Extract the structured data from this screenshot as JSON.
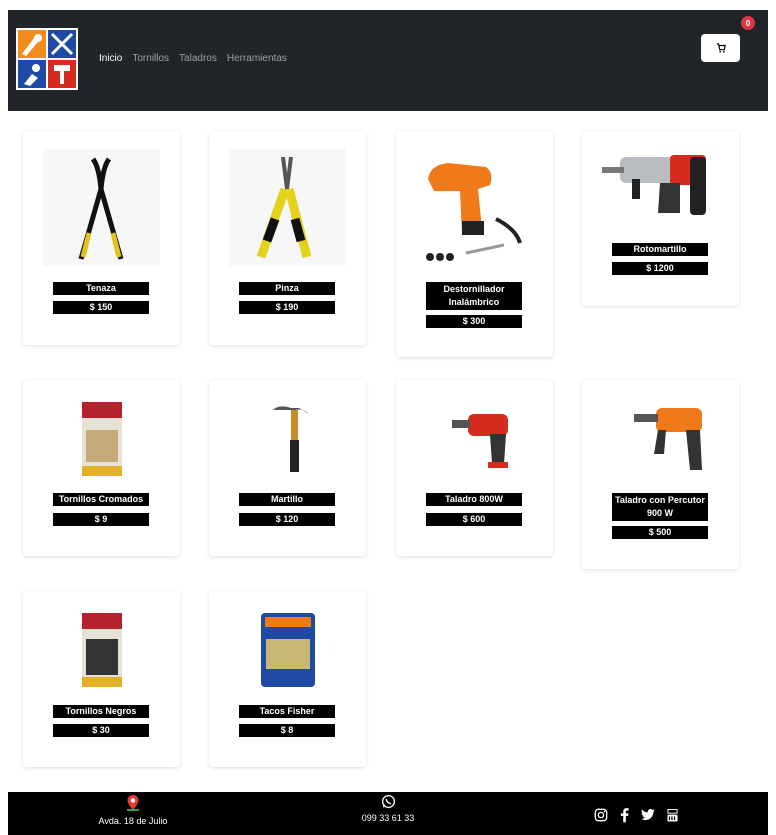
{
  "nav": {
    "links": [
      {
        "label": "Inicio"
      },
      {
        "label": "Tornillos"
      },
      {
        "label": "Taladros"
      },
      {
        "label": "Herramientas"
      }
    ],
    "cart_count": "0",
    "cart_icon": "cart-icon",
    "brand_colors": {
      "navbar": "#212529",
      "badge": "#dc3545",
      "logo_orange": "#f28c1e",
      "logo_blue": "#1f4aa3",
      "logo_red": "#d62b1f"
    }
  },
  "products": [
    {
      "name": "Tenaza",
      "price": "$ 150"
    },
    {
      "name": "Pinza",
      "price": "$ 190"
    },
    {
      "name": "Destornillador Inalámbrico",
      "price": "$ 300"
    },
    {
      "name": "Rotomartillo",
      "price": "$ 1200"
    },
    {
      "name": "Tornillos Cromados",
      "price": "$ 9"
    },
    {
      "name": "Martillo",
      "price": "$ 120"
    },
    {
      "name": "Taladro 800W",
      "price": "$ 600"
    },
    {
      "name": "Taladro con Percutor 900 W",
      "price": "$ 500"
    },
    {
      "name": "Tornillos Negros",
      "price": "$ 30"
    },
    {
      "name": "Tacos Fisher",
      "price": "$ 8"
    }
  ],
  "footer": {
    "address": "Avda. 18 de Julio",
    "phone": "099 33 61 33",
    "socials": [
      "instagram-icon",
      "facebook-icon",
      "twitter-icon",
      "youtube-icon"
    ]
  }
}
